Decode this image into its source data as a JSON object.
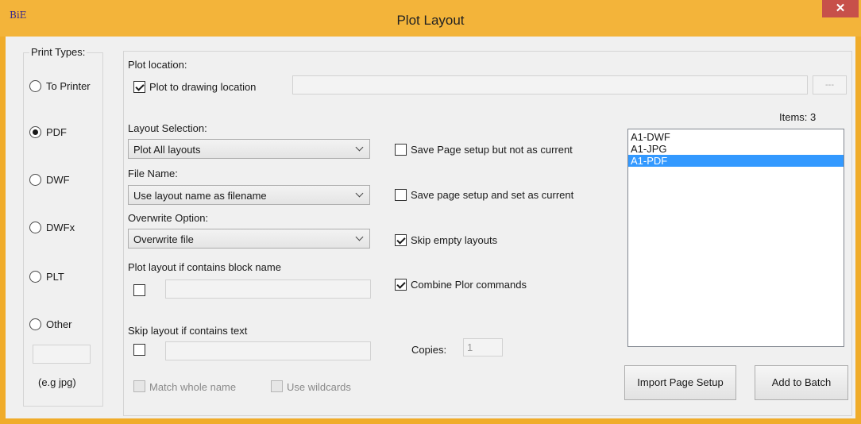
{
  "window": {
    "app_icon_text": "BiE",
    "title": "Plot Layout",
    "close_glyph": "✕"
  },
  "print_types": {
    "legend": "Print Types:",
    "options": [
      {
        "label": "To Printer",
        "selected": false
      },
      {
        "label": "PDF",
        "selected": true
      },
      {
        "label": "DWF",
        "selected": false
      },
      {
        "label": "DWFx",
        "selected": false
      },
      {
        "label": "PLT",
        "selected": false
      },
      {
        "label": "Other",
        "selected": false
      }
    ],
    "other_ext_value": "",
    "example_hint": "(e.g jpg)"
  },
  "plot_location": {
    "label": "Plot location:",
    "plot_to_drawing": {
      "label": "Plot to drawing location",
      "checked": true
    },
    "path_value": "",
    "browse_label": "---"
  },
  "layout_selection": {
    "label": "Layout Selection:",
    "value": "Plot All layouts"
  },
  "file_name": {
    "label": "File Name:",
    "value": "Use layout name as filename"
  },
  "overwrite": {
    "label": "Overwrite Option:",
    "value": "Overwrite file"
  },
  "block_filter": {
    "label": "Plot layout if contains block name",
    "checked": false,
    "value": ""
  },
  "skip_filter": {
    "label": "Skip layout if contains text",
    "checked": false,
    "value": ""
  },
  "match_whole_name": {
    "label": "Match whole name",
    "checked": false,
    "enabled": false
  },
  "use_wildcards": {
    "label": "Use wildcards",
    "checked": false,
    "enabled": false
  },
  "options": {
    "save_not_current": {
      "label": "Save Page setup but not as current",
      "checked": false
    },
    "save_set_current": {
      "label": "Save page setup and set as current",
      "checked": false
    },
    "skip_empty": {
      "label": "Skip empty layouts",
      "checked": true
    },
    "combine": {
      "label": "Combine Plor commands",
      "checked": true
    }
  },
  "copies": {
    "label": "Copies:",
    "value": "1"
  },
  "items": {
    "count_label": "Items: 3",
    "list": [
      {
        "label": "A1-DWF",
        "selected": false
      },
      {
        "label": "A1-JPG",
        "selected": false
      },
      {
        "label": "A1-PDF",
        "selected": true
      }
    ]
  },
  "buttons": {
    "import": "Import Page Setup",
    "add_to_batch": "Add to Batch"
  }
}
